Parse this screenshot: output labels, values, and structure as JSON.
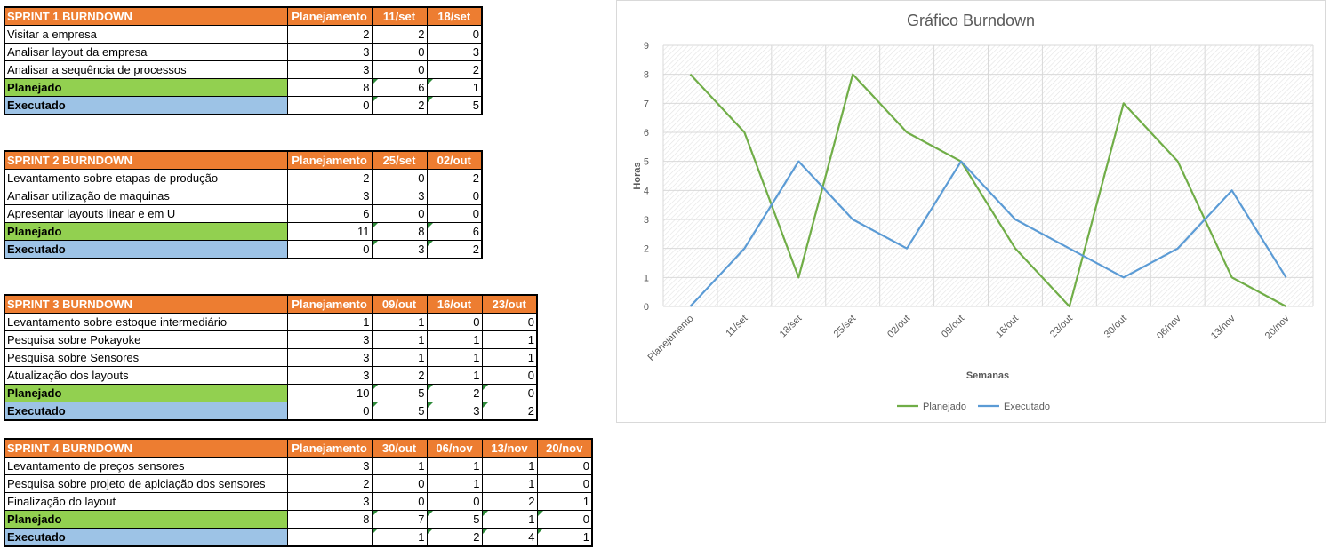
{
  "sprints": [
    {
      "title": "SPRINT 1 BURNDOWN",
      "columns": [
        "Planejamento",
        "11/set",
        "18/set"
      ],
      "tasks": [
        {
          "label": "Visitar a empresa",
          "values": [
            "2",
            "2",
            "0"
          ]
        },
        {
          "label": "Analisar layout da empresa",
          "values": [
            "3",
            "0",
            "3"
          ]
        },
        {
          "label": "Analisar a sequência de processos",
          "values": [
            "3",
            "0",
            "2"
          ]
        }
      ],
      "planejado": {
        "label": "Planejado",
        "values": [
          "8",
          "6",
          "1"
        ]
      },
      "executado": {
        "label": "Executado",
        "values": [
          "0",
          "2",
          "5"
        ]
      }
    },
    {
      "title": "SPRINT 2 BURNDOWN",
      "columns": [
        "Planejamento",
        "25/set",
        "02/out"
      ],
      "tasks": [
        {
          "label": "Levantamento sobre etapas de produção",
          "values": [
            "2",
            "0",
            "2"
          ]
        },
        {
          "label": "Analisar utilização de maquinas",
          "values": [
            "3",
            "3",
            "0"
          ]
        },
        {
          "label": "Apresentar layouts linear e em U",
          "values": [
            "6",
            "0",
            "0"
          ]
        }
      ],
      "planejado": {
        "label": "Planejado",
        "values": [
          "11",
          "8",
          "6"
        ]
      },
      "executado": {
        "label": "Executado",
        "values": [
          "0",
          "3",
          "2"
        ]
      }
    },
    {
      "title": "SPRINT 3 BURNDOWN",
      "columns": [
        "Planejamento",
        "09/out",
        "16/out",
        "23/out"
      ],
      "tasks": [
        {
          "label": "Levantamento sobre estoque intermediário",
          "values": [
            "1",
            "1",
            "0",
            "0"
          ]
        },
        {
          "label": "Pesquisa sobre Pokayoke",
          "values": [
            "3",
            "1",
            "1",
            "1"
          ]
        },
        {
          "label": "Pesquisa sobre Sensores",
          "values": [
            "3",
            "1",
            "1",
            "1"
          ]
        },
        {
          "label": "Atualização dos layouts",
          "values": [
            "3",
            "2",
            "1",
            "0"
          ]
        }
      ],
      "planejado": {
        "label": "Planejado",
        "values": [
          "10",
          "5",
          "2",
          "0"
        ]
      },
      "executado": {
        "label": "Executado",
        "values": [
          "0",
          "5",
          "3",
          "2"
        ]
      }
    },
    {
      "title": "SPRINT 4 BURNDOWN",
      "columns": [
        "Planejamento",
        "30/out",
        "06/nov",
        "13/nov",
        "20/nov"
      ],
      "tasks": [
        {
          "label": "Levantamento de preços sensores",
          "values": [
            "3",
            "1",
            "1",
            "1",
            "0"
          ]
        },
        {
          "label": "Pesquisa sobre projeto de aplciação dos sensores",
          "values": [
            "2",
            "0",
            "1",
            "1",
            "0"
          ]
        },
        {
          "label": "Finalização do layout",
          "values": [
            "3",
            "0",
            "0",
            "2",
            "1"
          ]
        }
      ],
      "planejado": {
        "label": "Planejado",
        "values": [
          "8",
          "7",
          "5",
          "1",
          "0"
        ]
      },
      "executado": {
        "label": "Executado",
        "values": [
          "",
          "1",
          "2",
          "4",
          "1"
        ]
      }
    }
  ],
  "chart_data": {
    "type": "line",
    "title": "Gráfico Burndown",
    "xlabel": "Semanas",
    "ylabel": "Horas",
    "categories": [
      "Planejamento",
      "11/set",
      "18/set",
      "25/set",
      "02/out",
      "09/out",
      "16/out",
      "23/out",
      "30/out",
      "06/nov",
      "13/nov",
      "20/nov"
    ],
    "ylim": [
      0,
      9
    ],
    "yticks": [
      0,
      1,
      2,
      3,
      4,
      5,
      6,
      7,
      8,
      9
    ],
    "grid": true,
    "legend": "bottom",
    "series": [
      {
        "name": "Planejado",
        "color": "#70AD47",
        "values": [
          8,
          6,
          1,
          8,
          6,
          5,
          2,
          0,
          7,
          5,
          1,
          0
        ]
      },
      {
        "name": "Executado",
        "color": "#5B9BD5",
        "values": [
          0,
          2,
          5,
          3,
          2,
          5,
          3,
          2,
          1,
          2,
          4,
          1
        ]
      }
    ]
  }
}
